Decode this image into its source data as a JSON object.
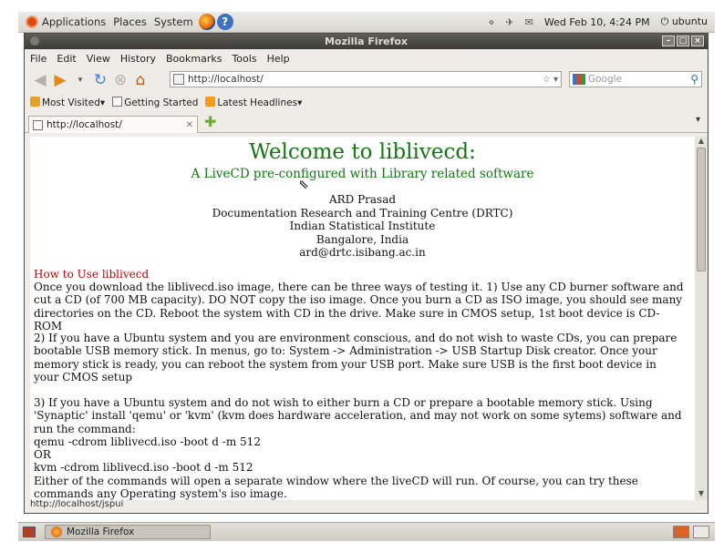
{
  "top_panel": {
    "menus": [
      "Applications",
      "Places",
      "System"
    ],
    "datetime": "Wed Feb 10,  4:24 PM",
    "user": "ubuntu"
  },
  "window": {
    "title": "Mozilla Firefox",
    "menu": [
      "File",
      "Edit",
      "View",
      "History",
      "Bookmarks",
      "Tools",
      "Help"
    ],
    "url": "http://localhost/",
    "search_placeholder": "Google",
    "bookmarks": [
      "Most Visited",
      "Getting Started",
      "Latest Headlines"
    ],
    "tab_label": "http://localhost/",
    "status": "http://localhost/jspui"
  },
  "page": {
    "heading": "Welcome to liblivecd:",
    "subheading": "A LiveCD pre-configured with Library related software",
    "author": [
      "ARD Prasad",
      "Documentation Research and Training Centre (DRTC)",
      "Indian Statistical Institute",
      "Bangalore, India",
      "ard@drtc.isibang.ac.in"
    ],
    "howto_title": "How to Use liblivecd",
    "para1": "Once you download the liblivecd.iso image, there can be three ways of testing it. 1) Use any CD burner software and cut a CD (of 700 MB capacity). DO NOT copy the iso image. Once you burn a CD as ISO image, you should see many directories on the CD. Reboot the system with CD in the drive. Make sure in CMOS setup, 1st boot device is CD-ROM",
    "para2": "2) If you have a Ubuntu system and you are environment conscious, and do not wish to waste CDs, you can prepare bootable USB memory stick. In menus, go to: System -> Administration -> USB Startup Disk creator. Once your memory stick is ready, you can reboot the system from your USB port. Make sure USB is the first boot device in your CMOS setup",
    "para3_lines": [
      "3) If you have a Ubuntu system and do not wish to either burn a CD or prepare a bootable memory stick. Using 'Synaptic' install 'qemu' or 'kvm' (kvm does hardware acceleration, and may not work on some sytems) software and run the command:",
      "qemu -cdrom liblivecd.iso -boot d -m 512",
      "OR",
      "kvm -cdrom liblivecd.iso -boot d -m 512",
      "Either of the commands will open a separate window where the liveCD will run. Of course, you can try these commands any Operating system's iso image."
    ]
  },
  "bottom_panel": {
    "task": "Mozilla Firefox"
  }
}
